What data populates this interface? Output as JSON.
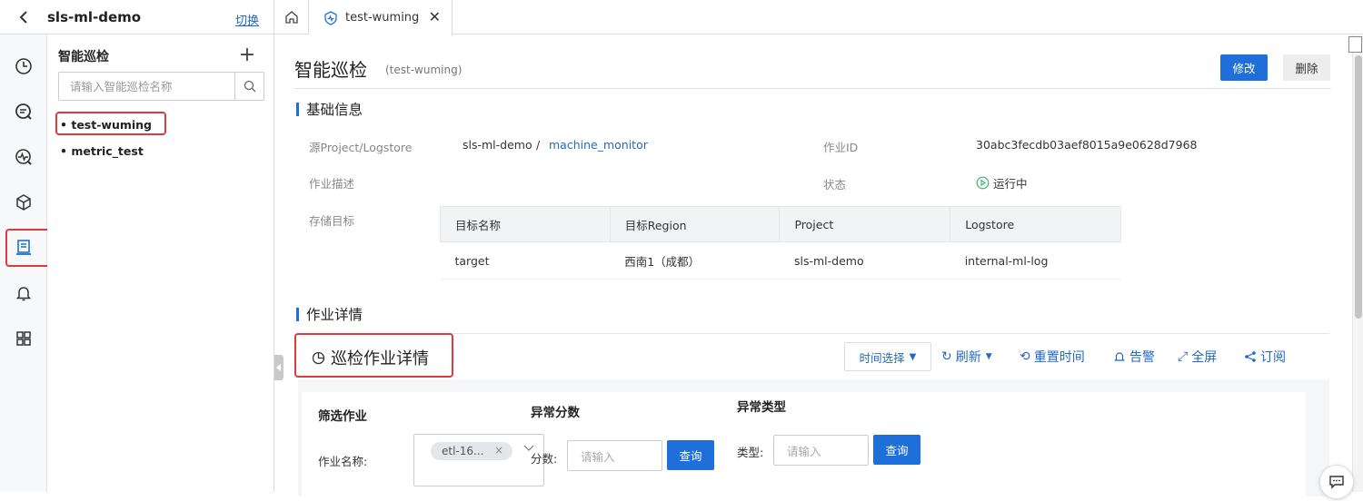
{
  "header": {
    "project_name": "sls-ml-demo",
    "switch_label": "切换",
    "active_tab_label": "test-wuming"
  },
  "rail": {
    "icons": [
      "clock-icon",
      "search-log-icon",
      "dashboard-icon",
      "cube-icon",
      "inspection-icon",
      "bell-icon",
      "grid-icon"
    ],
    "selected_index": 4
  },
  "list_panel": {
    "title": "智能巡检",
    "search_placeholder": "请输入智能巡检名称",
    "items": [
      {
        "label": "test-wuming",
        "selected": true
      },
      {
        "label": "metric_test",
        "selected": false
      }
    ]
  },
  "main": {
    "title": "智能巡检",
    "subtitle": "(test-wuming)",
    "edit_label": "修改",
    "delete_label": "删除",
    "basic_section": "基础信息",
    "source_label": "源Project/Logstore",
    "source_project": "sls-ml-demo",
    "source_sep": "/",
    "source_logstore": "machine_monitor",
    "job_id_label": "作业ID",
    "job_id": "30abc3fecdb03aef8015a9e0628d7968",
    "desc_label": "作业描述",
    "status_label": "状态",
    "status_value": "运行中",
    "storage_label": "存储目标",
    "storage_table": {
      "headers": [
        "目标名称",
        "目标Region",
        "Project",
        "Logstore"
      ],
      "rows": [
        [
          "target",
          "西南1（成都）",
          "sls-ml-demo",
          "internal-ml-log"
        ]
      ]
    },
    "detail_section": "作业详情"
  },
  "dashboard": {
    "title": "巡检作业详情",
    "time_select": "时间选择",
    "refresh": "刷新",
    "reset_time": "重置时间",
    "alert": "告警",
    "fullscreen": "全屏",
    "subscribe": "订阅",
    "filters": {
      "job_filter_title": "筛选作业",
      "job_name_label": "作业名称:",
      "job_tag": "etl-16...",
      "score_title": "异常分数",
      "score_label": "分数:",
      "score_placeholder": "请输入",
      "type_title": "异常类型",
      "type_label": "类型:",
      "type_placeholder": "请输入",
      "query_label": "查询"
    }
  },
  "colors": {
    "accent": "#1e6fd9",
    "highlight": "#e0393b",
    "status_green": "#3cb371"
  }
}
